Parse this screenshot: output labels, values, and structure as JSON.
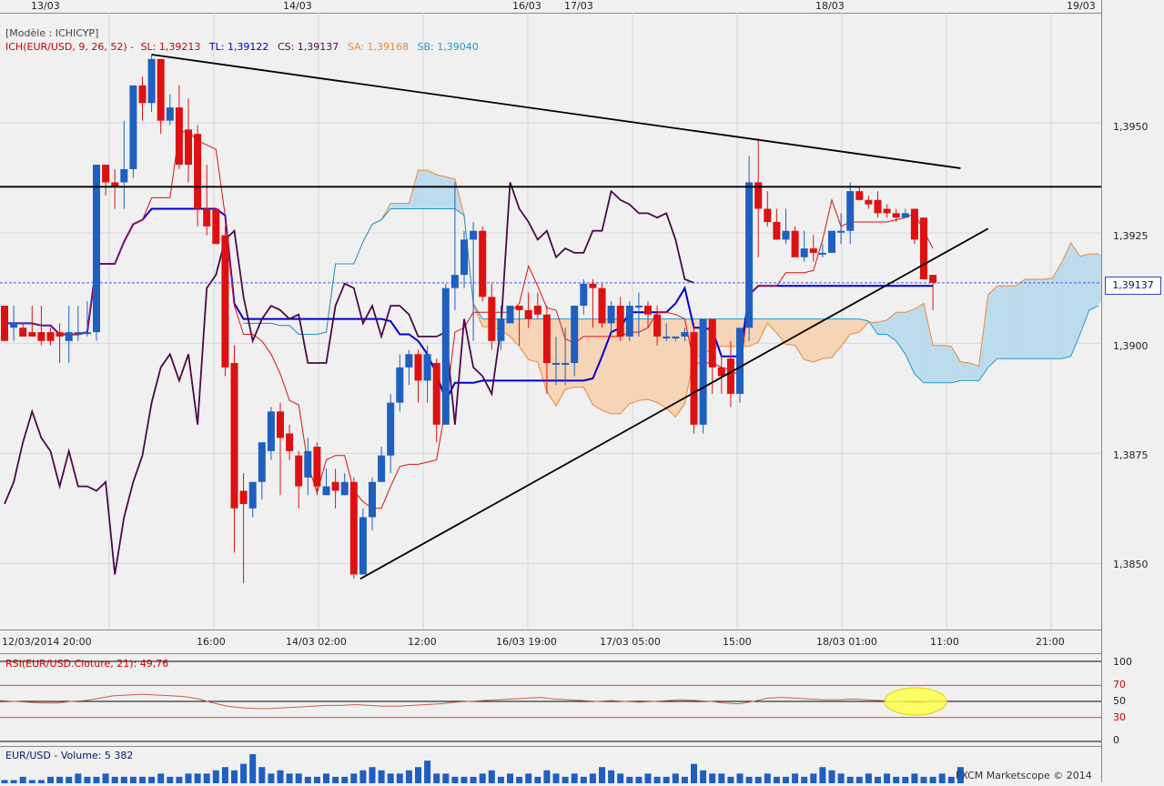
{
  "header": {
    "model_label": "[Modèle : ICHICYP]",
    "indicator_name": "ICH(EUR/USD, 9, 26, 52) -",
    "sl": "SL: 1,39213",
    "tl": "TL: 1,39122",
    "cs": "CS: 1,39137",
    "sa": "SA: 1,39168",
    "sb": "SB: 1,39040"
  },
  "colors": {
    "bull": "#1f5fbf",
    "bear": "#dd1111",
    "tenkan": "#dd1111",
    "kijun": "#0000cc",
    "chikou": "#4a0a4a",
    "senkou_a": "#ee8833",
    "senkou_b": "#2299cc",
    "kumo_bull_fill": "#bcdcee",
    "kumo_bear_fill": "#f6d4b6"
  },
  "top_dates": [
    "13/03",
    "14/03",
    "16/03",
    "17/03",
    "18/03",
    "19/03"
  ],
  "bottom_times": [
    "12/03/2014 20:00",
    "16:00",
    "14/03 02:00",
    "12:00",
    "16/03 19:00",
    "17/03 05:00",
    "15:00",
    "18/03 01:00",
    "11:00",
    "21:00"
  ],
  "current_price_label": "1,39137",
  "rsi": {
    "label": "RSI(EUR/USD.Cloture, 21): 49,76",
    "levels": [
      "100",
      "70",
      "50",
      "30",
      "0"
    ]
  },
  "volume": {
    "label": "EUR/USD - Volume: 5 382"
  },
  "footer": {
    "copyright": "FXCM Marketscope © 2014"
  },
  "chart_data": {
    "type": "candlestick",
    "instrument": "EUR/USD",
    "y_ticks": [
      "1,3950",
      "1,3925",
      "1,3900",
      "1,3875",
      "1,3850"
    ],
    "y_tick_values": [
      1.395,
      1.3925,
      1.39,
      1.3875,
      1.385
    ],
    "ylim": [
      1.3835,
      1.3975
    ],
    "candles": [
      [
        1.39085,
        1.39085,
        1.39005,
        1.39005
      ],
      [
        1.39035,
        1.39085,
        1.39005,
        1.39045
      ],
      [
        1.39035,
        1.39045,
        1.39015,
        1.39015
      ],
      [
        1.39025,
        1.39085,
        1.39015,
        1.39015
      ],
      [
        1.39025,
        1.39085,
        1.38995,
        1.39005
      ],
      [
        1.39025,
        1.39035,
        1.38995,
        1.39005
      ],
      [
        1.39025,
        1.39045,
        1.38955,
        1.39015
      ],
      [
        1.39005,
        1.39085,
        1.38955,
        1.39025
      ],
      [
        1.39025,
        1.39085,
        1.39005,
        1.39025
      ],
      [
        1.39025,
        1.39095,
        1.39015,
        1.39025
      ],
      [
        1.39025,
        1.39405,
        1.39005,
        1.39405
      ],
      [
        1.39405,
        1.39405,
        1.39335,
        1.39365
      ],
      [
        1.39365,
        1.39395,
        1.39305,
        1.39355
      ],
      [
        1.39365,
        1.39505,
        1.39305,
        1.39395
      ],
      [
        1.39395,
        1.39585,
        1.39375,
        1.39585
      ],
      [
        1.39585,
        1.39605,
        1.39505,
        1.39545
      ],
      [
        1.39545,
        1.39655,
        1.39525,
        1.39645
      ],
      [
        1.39645,
        1.39645,
        1.39475,
        1.39505
      ],
      [
        1.39505,
        1.39565,
        1.39495,
        1.39535
      ],
      [
        1.39535,
        1.39585,
        1.39395,
        1.39405
      ],
      [
        1.39485,
        1.39555,
        1.39365,
        1.39405
      ],
      [
        1.39475,
        1.39495,
        1.39265,
        1.39305
      ],
      [
        1.39305,
        1.39405,
        1.39245,
        1.39265
      ],
      [
        1.39305,
        1.39285,
        1.39225,
        1.39225
      ],
      [
        1.39245,
        1.39265,
        1.38925,
        1.38945
      ],
      [
        1.38955,
        1.38995,
        1.38525,
        1.38625
      ],
      [
        1.38665,
        1.38705,
        1.38455,
        1.38635
      ],
      [
        1.38625,
        1.38685,
        1.38605,
        1.38685
      ],
      [
        1.38685,
        1.38765,
        1.38645,
        1.38775
      ],
      [
        1.38755,
        1.38855,
        1.38735,
        1.38845
      ],
      [
        1.38845,
        1.38865,
        1.38655,
        1.38785
      ],
      [
        1.38795,
        1.38815,
        1.38735,
        1.38755
      ],
      [
        1.38745,
        1.38755,
        1.38625,
        1.38675
      ],
      [
        1.38695,
        1.38785,
        1.38655,
        1.38755
      ],
      [
        1.38765,
        1.38775,
        1.38655,
        1.38675
      ],
      [
        1.38655,
        1.38715,
        1.38655,
        1.38675
      ],
      [
        1.38685,
        1.38715,
        1.38625,
        1.38665
      ],
      [
        1.38655,
        1.38705,
        1.38655,
        1.38685
      ],
      [
        1.38685,
        1.38695,
        1.38465,
        1.38475
      ],
      [
        1.38475,
        1.38625,
        1.38475,
        1.38605
      ],
      [
        1.38605,
        1.38695,
        1.38575,
        1.38685
      ],
      [
        1.38685,
        1.38765,
        1.38685,
        1.38745
      ],
      [
        1.38745,
        1.38885,
        1.38705,
        1.38865
      ],
      [
        1.38865,
        1.38975,
        1.38845,
        1.38945
      ],
      [
        1.38945,
        1.38985,
        1.38905,
        1.38975
      ],
      [
        1.38975,
        1.38985,
        1.38865,
        1.38915
      ],
      [
        1.38915,
        1.38995,
        1.38865,
        1.38975
      ],
      [
        1.38955,
        1.38965,
        1.38775,
        1.38815
      ],
      [
        1.38815,
        1.39135,
        1.38815,
        1.39125
      ],
      [
        1.39125,
        1.39365,
        1.39075,
        1.39155
      ],
      [
        1.39155,
        1.39255,
        1.39125,
        1.39235
      ],
      [
        1.39235,
        1.39275,
        1.39005,
        1.39255
      ],
      [
        1.39255,
        1.39265,
        1.39095,
        1.39105
      ],
      [
        1.39105,
        1.39135,
        1.38985,
        1.39005
      ],
      [
        1.39005,
        1.39085,
        1.38985,
        1.39055
      ],
      [
        1.39045,
        1.39085,
        1.39045,
        1.39085
      ],
      [
        1.39085,
        1.39085,
        1.38995,
        1.39075
      ],
      [
        1.39075,
        1.39115,
        1.39035,
        1.39055
      ],
      [
        1.39085,
        1.39115,
        1.39055,
        1.39065
      ],
      [
        1.39065,
        1.39085,
        1.38885,
        1.38955
      ],
      [
        1.38955,
        1.39015,
        1.38905,
        1.38955
      ],
      [
        1.38955,
        1.39035,
        1.38905,
        1.38955
      ],
      [
        1.38955,
        1.39085,
        1.38925,
        1.39085
      ],
      [
        1.39085,
        1.39145,
        1.39065,
        1.39135
      ],
      [
        1.39135,
        1.39145,
        1.39035,
        1.39125
      ],
      [
        1.39125,
        1.39135,
        1.39035,
        1.39045
      ],
      [
        1.39045,
        1.39095,
        1.39025,
        1.39085
      ],
      [
        1.39085,
        1.39105,
        1.39005,
        1.39015
      ],
      [
        1.39015,
        1.39095,
        1.39005,
        1.39085
      ],
      [
        1.39085,
        1.39115,
        1.39015,
        1.39085
      ],
      [
        1.39085,
        1.39095,
        1.39035,
        1.39065
      ],
      [
        1.39065,
        1.39085,
        1.38995,
        1.39015
      ],
      [
        1.39015,
        1.39045,
        1.39005,
        1.39015
      ],
      [
        1.39015,
        1.39015,
        1.39005,
        1.39015
      ],
      [
        1.39015,
        1.39035,
        1.39005,
        1.39025
      ],
      [
        1.39025,
        1.39045,
        1.38795,
        1.38815
      ],
      [
        1.38815,
        1.39055,
        1.38795,
        1.39055
      ],
      [
        1.39055,
        1.39055,
        1.38885,
        1.38945
      ],
      [
        1.38945,
        1.38975,
        1.38885,
        1.38925
      ],
      [
        1.38965,
        1.39005,
        1.38855,
        1.38885
      ],
      [
        1.38885,
        1.39005,
        1.38865,
        1.39035
      ],
      [
        1.39035,
        1.39425,
        1.39005,
        1.39365
      ],
      [
        1.39365,
        1.39465,
        1.39195,
        1.39305
      ],
      [
        1.39305,
        1.39345,
        1.39265,
        1.39275
      ],
      [
        1.39275,
        1.39305,
        1.39235,
        1.39235
      ],
      [
        1.39235,
        1.39305,
        1.39225,
        1.39255
      ],
      [
        1.39255,
        1.39265,
        1.39195,
        1.39195
      ],
      [
        1.39195,
        1.39255,
        1.39185,
        1.39215
      ],
      [
        1.39215,
        1.39245,
        1.39185,
        1.39205
      ],
      [
        1.39205,
        1.39225,
        1.39195,
        1.39205
      ],
      [
        1.39205,
        1.39255,
        1.39205,
        1.39255
      ],
      [
        1.39255,
        1.39295,
        1.39225,
        1.39255
      ],
      [
        1.39255,
        1.39365,
        1.39225,
        1.39345
      ],
      [
        1.39345,
        1.39355,
        1.39325,
        1.39325
      ],
      [
        1.39325,
        1.39335,
        1.39305,
        1.39315
      ],
      [
        1.39325,
        1.39345,
        1.39285,
        1.39295
      ],
      [
        1.39305,
        1.39315,
        1.39285,
        1.39295
      ],
      [
        1.39295,
        1.39305,
        1.39275,
        1.39285
      ],
      [
        1.39285,
        1.39305,
        1.39285,
        1.39295
      ],
      [
        1.39305,
        1.39305,
        1.39225,
        1.39235
      ],
      [
        1.39285,
        1.39285,
        1.39145,
        1.39145
      ],
      [
        1.39155,
        1.39155,
        1.39075,
        1.39137
      ]
    ],
    "rsi_values": [
      51,
      50,
      49,
      48,
      48,
      50,
      51,
      54,
      57,
      58,
      59,
      58,
      57,
      56,
      53,
      48,
      44,
      42,
      41,
      41,
      42,
      43,
      44,
      45,
      45,
      46,
      45,
      44,
      44,
      45,
      46,
      47,
      49,
      50,
      51,
      52,
      53,
      54,
      55,
      53,
      52,
      51,
      50,
      51,
      50,
      49,
      50,
      51,
      52,
      51,
      50,
      48,
      47,
      50,
      54,
      55,
      54,
      53,
      52,
      52,
      53,
      52,
      51,
      50,
      49,
      49
    ],
    "volume_values": [
      1,
      1,
      2,
      1,
      1,
      2,
      2,
      2,
      3,
      2,
      2,
      3,
      2,
      2,
      2,
      2,
      2,
      3,
      2,
      2,
      3,
      3,
      3,
      4,
      5,
      4,
      6,
      9,
      5,
      3,
      4,
      3,
      3,
      2,
      2,
      3,
      2,
      2,
      3,
      4,
      5,
      4,
      3,
      3,
      4,
      5,
      7,
      3,
      3,
      2,
      2,
      2,
      3,
      4,
      2,
      3,
      2,
      3,
      2,
      4,
      3,
      2,
      3,
      2,
      3,
      5,
      4,
      3,
      2,
      2,
      3,
      2,
      2,
      3,
      2,
      6,
      4,
      3,
      3,
      2,
      3,
      2,
      2,
      3,
      2,
      2,
      3,
      2,
      3,
      5,
      4,
      3,
      2,
      2,
      3,
      2,
      3,
      2,
      2,
      3,
      2,
      2,
      3,
      2,
      5
    ]
  }
}
